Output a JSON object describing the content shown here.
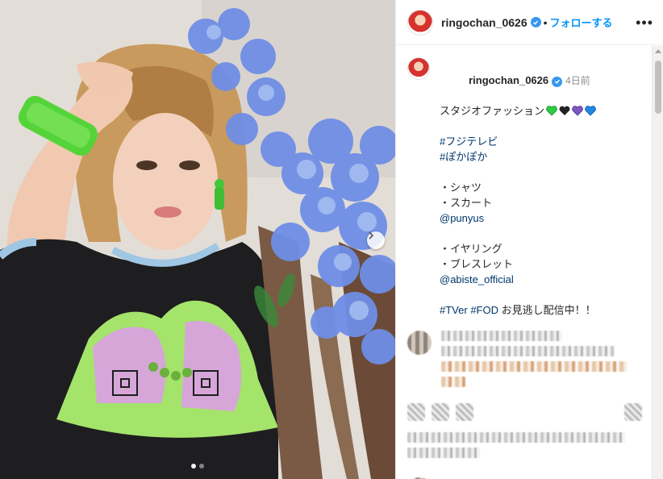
{
  "post": {
    "username": "ringochan_0626",
    "header_separator": "•",
    "follow_label": "フォローする",
    "more_icon": "more-horizontal-icon",
    "verified_icon": "verified-badge-icon"
  },
  "caption": {
    "username": "ringochan_0626",
    "time": "4日前",
    "line1": "スタジオファッション",
    "hearts": [
      {
        "icon": "green-heart-icon",
        "color": "#2ecc40"
      },
      {
        "icon": "black-heart-icon",
        "color": "#222222"
      },
      {
        "icon": "purple-heart-icon",
        "color": "#7e57c2"
      },
      {
        "icon": "blue-heart-icon",
        "color": "#1e88e5"
      }
    ],
    "hashtag1": "#フジテレビ",
    "hashtag2": "#ぽかぽか",
    "item_shirt": "・シャツ",
    "item_skirt": "・スカート",
    "mention1": "@punyus",
    "item_earring": "・イヤリング",
    "item_bracelet": "・ブレスレット",
    "mention2": "@abiste_official",
    "tag_tver": "#TVer",
    "tag_fod": "#FOD",
    "tail_text": " お見逃し配信中！！"
  },
  "carousel": {
    "dots": 2,
    "active_index": 0,
    "next_icon": "chevron-right-icon"
  },
  "colors": {
    "link": "#00376b",
    "follow": "#0095f6",
    "verified": "#3897f0",
    "muted": "#8e8e8e"
  }
}
